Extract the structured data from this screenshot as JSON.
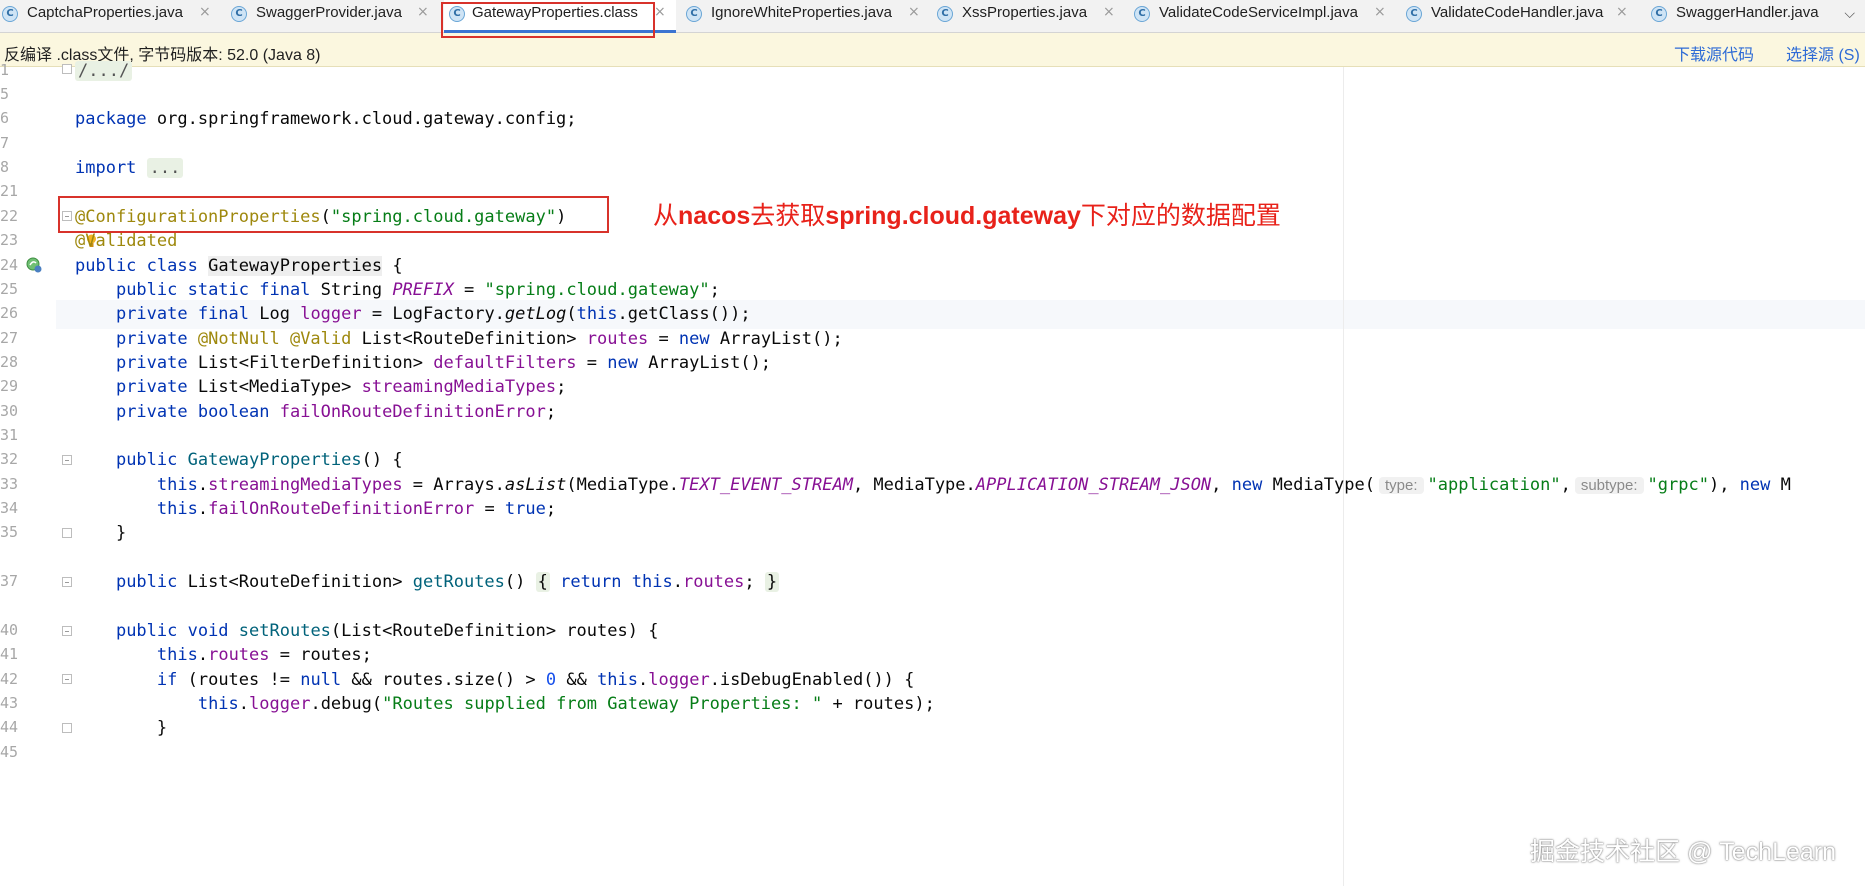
{
  "tabs": [
    {
      "label": "CaptchaProperties.java",
      "icon": "class-c-icon"
    },
    {
      "label": "SwaggerProvider.java",
      "icon": "class-c-icon"
    },
    {
      "label": "GatewayProperties.class",
      "icon": "class-c-icon",
      "active": true
    },
    {
      "label": "IgnoreWhiteProperties.java",
      "icon": "class-c-icon"
    },
    {
      "label": "XssProperties.java",
      "icon": "class-c-icon"
    },
    {
      "label": "ValidateCodeServiceImpl.java",
      "icon": "class-c-icon"
    },
    {
      "label": "ValidateCodeHandler.java",
      "icon": "class-c-icon"
    },
    {
      "label": "SwaggerHandler.java",
      "icon": "class-c-icon"
    }
  ],
  "tab_icon_glyph": "C",
  "tab_close_glyph": "×",
  "tab_menu_glyph": "⌵",
  "banner": {
    "message": "反编译 .class文件, 字节码版本: 52.0 (Java 8)",
    "download_source": "下载源代码",
    "choose_source": "选择源 (S)"
  },
  "line_numbers": [
    "1",
    "5",
    "6",
    "7",
    "8",
    "21",
    "22",
    "23",
    "24",
    "25",
    "26",
    "27",
    "28",
    "29",
    "30",
    "31",
    "32",
    "33",
    "34",
    "35",
    "37",
    "40",
    "41",
    "42",
    "43",
    "44",
    "45"
  ],
  "code": {
    "l1": "/.../",
    "l6_kw": "package",
    "l6_rest": " org.springframework.cloud.gateway.config;",
    "l8_kw": "import",
    "l8_fold": "...",
    "l22_ann": "@ConfigurationProperties",
    "l22_open": "(",
    "l22_str": "\"spring.cloud.gateway\"",
    "l22_close": ")",
    "l23_at": "@",
    "l23_rest": "Validated",
    "l24_kw": "public class",
    "l24_name": "GatewayProperties",
    "l24_brace": " {",
    "l25_kw": "public static final",
    "l25_type": " String ",
    "l25_field": "PREFIX",
    "l25_eq": " = ",
    "l25_str": "\"spring.cloud.gateway\"",
    "l25_end": ";",
    "l26_kw": "private final",
    "l26_type": " Log ",
    "l26_field": "logger",
    "l26_mid": " = LogFactory.",
    "l26_method": "getLog",
    "l26_open": "(",
    "l26_this": "this",
    "l26_end": ".getClass());",
    "l27_kw": "private",
    "l27_ann": " @NotNull @Valid",
    "l27_type": " List<RouteDefinition> ",
    "l27_field": "routes",
    "l27_eq": " = ",
    "l27_new": "new",
    "l27_end": " ArrayList();",
    "l28_kw": "private",
    "l28_type": " List<FilterDefinition> ",
    "l28_field": "defaultFilters",
    "l28_eq": " = ",
    "l28_new": "new",
    "l28_end": " ArrayList();",
    "l29_kw": "private",
    "l29_type": " List<MediaType> ",
    "l29_field": "streamingMediaTypes",
    "l29_end": ";",
    "l30_kw": "private boolean",
    "l30_sp": " ",
    "l30_field": "failOnRouteDefinitionError",
    "l30_end": ";",
    "l32_kw": "public",
    "l32_sp": " ",
    "l32_name": "GatewayProperties",
    "l32_end": "() {",
    "l33_this": "this",
    "l33_dot": ".",
    "l33_field": "streamingMediaTypes",
    "l33_mid": " = Arrays.",
    "l33_method": "asList",
    "l33_a": "(MediaType.",
    "l33_c1": "TEXT_EVENT_STREAM",
    "l33_b": ", MediaType.",
    "l33_c2": "APPLICATION_STREAM_JSON",
    "l33_comma": ", ",
    "l33_new": "new",
    "l33_mt": " MediaType(",
    "l33_hint1": "type:",
    "l33_s1": "\"application\"",
    "l33_c": ",",
    "l33_hint2": "subtype:",
    "l33_s2": "\"grpc\"",
    "l33_d": "), ",
    "l33_new2": "new",
    "l33_tail": " M",
    "l34_this": "this",
    "l34_dot": ".",
    "l34_field": "failOnRouteDefinitionError",
    "l34_eq": " = ",
    "l34_true": "true",
    "l34_end": ";",
    "l35": "}",
    "l37_kw": "public",
    "l37_type": " List<RouteDefinition> ",
    "l37_name": "getRoutes",
    "l37_paren": "() ",
    "l37_ob": "{",
    "l37_ret": " return ",
    "l37_this": "this",
    "l37_dot": ".",
    "l37_field": "routes",
    "l37_semi": "; ",
    "l37_cb": "}",
    "l41_kw": "public void",
    "l41_sp": " ",
    "l41_name": "setRoutes",
    "l41_end": "(List<RouteDefinition> routes) {",
    "l42_this": "this",
    "l42_dot": ".",
    "l42_field": "routes",
    "l42_end": " = routes;",
    "l43_if": "if",
    "l43_a": " (routes != ",
    "l43_null": "null",
    "l43_b": " && routes.size() > ",
    "l43_zero": "0",
    "l43_c": " && ",
    "l43_this": "this",
    "l43_dot": ".",
    "l43_field": "logger",
    "l43_end": ".isDebugEnabled()) {",
    "l44_this": "this",
    "l44_dot": ".",
    "l44_field": "logger",
    "l44_mid": ".debug(",
    "l44_str": "\"Routes supplied from Gateway Properties: \"",
    "l44_end": " + routes);",
    "l45": "}"
  },
  "annotation_note": {
    "p1": "从",
    "b1": "nacos",
    "p2": "去获取",
    "b2": "spring.cloud.gateway",
    "p3": "下对应的数据配置"
  },
  "watermark": "掘金技术社区 @ TechLearn",
  "colors": {
    "keyword": "#0033b3",
    "string": "#067d17",
    "annotation": "#9e880d",
    "field": "#871094",
    "annotation_red": "#e8221a",
    "link_blue": "#2e6bd6",
    "banner_bg": "#fbf7df"
  }
}
